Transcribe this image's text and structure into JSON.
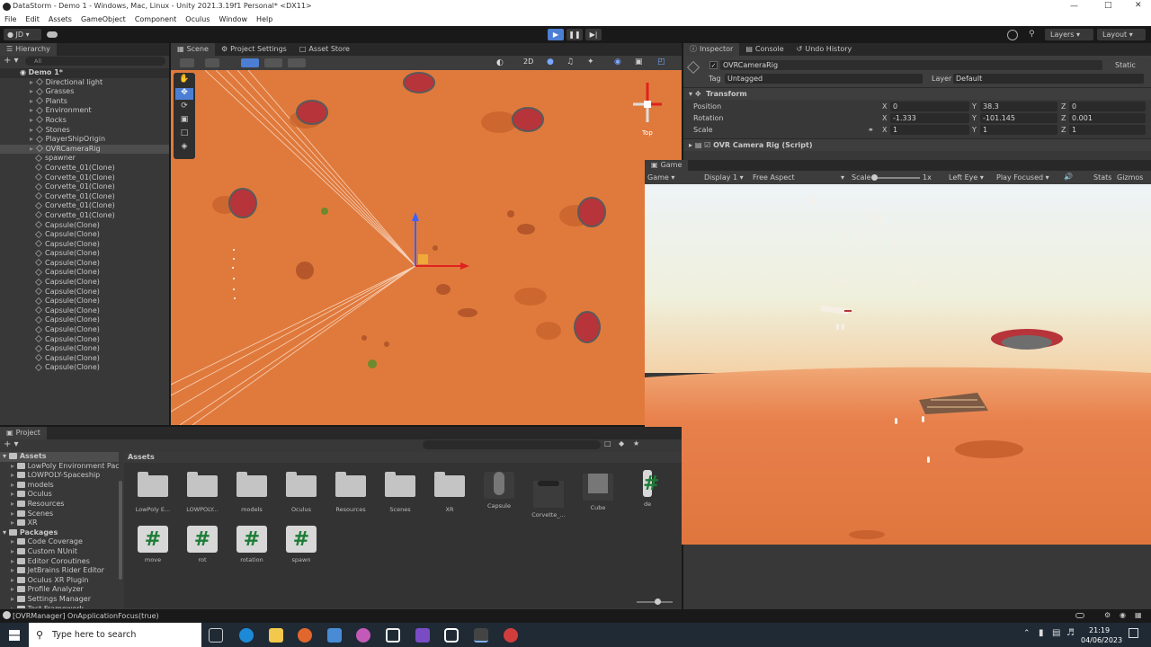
{
  "window": {
    "title": "DataStorm - Demo 1 - Windows, Mac, Linux - Unity 2021.3.19f1 Personal* <DX11>"
  },
  "menu": [
    "File",
    "Edit",
    "Assets",
    "GameObject",
    "Component",
    "Oculus",
    "Window",
    "Help"
  ],
  "toolbar": {
    "account": "JD",
    "layers": "Layers",
    "layout": "Layout"
  },
  "hierarchy": {
    "tab": "Hierarchy",
    "search_placeholder": "All",
    "scene": "Demo 1*",
    "items": [
      "Directional light",
      "Grasses",
      "Plants",
      "Environment",
      "Rocks",
      "Stones",
      "PlayerShipOrigin",
      "OVRCameraRig",
      "spawner",
      "Corvette_01(Clone)",
      "Corvette_01(Clone)",
      "Corvette_01(Clone)",
      "Corvette_01(Clone)",
      "Corvette_01(Clone)",
      "Corvette_01(Clone)",
      "Capsule(Clone)",
      "Capsule(Clone)",
      "Capsule(Clone)",
      "Capsule(Clone)",
      "Capsule(Clone)",
      "Capsule(Clone)",
      "Capsule(Clone)",
      "Capsule(Clone)",
      "Capsule(Clone)",
      "Capsule(Clone)",
      "Capsule(Clone)",
      "Capsule(Clone)",
      "Capsule(Clone)",
      "Capsule(Clone)",
      "Capsule(Clone)",
      "Capsule(Clone)"
    ]
  },
  "scene_tabs": [
    "Scene",
    "Project Settings",
    "Asset Store"
  ],
  "scene": {
    "mode_2d": "2D",
    "gizmo_view": "Top"
  },
  "inspector": {
    "tabs": [
      "Inspector",
      "Console",
      "Undo History"
    ],
    "object_name": "OVRCameraRig",
    "static_label": "Static",
    "tag_label": "Tag",
    "tag_value": "Untagged",
    "layer_label": "Layer",
    "layer_value": "Default",
    "transform": "Transform",
    "position": {
      "label": "Position",
      "x": "0",
      "y": "38.3",
      "z": "0"
    },
    "rotation": {
      "label": "Rotation",
      "x": "-1.333",
      "y": "-101.145",
      "z": "0.001"
    },
    "scale": {
      "label": "Scale",
      "x": "1",
      "y": "1",
      "z": "1"
    },
    "component": "OVR Camera Rig (Script)"
  },
  "game": {
    "tab": "Game",
    "display_mode": "Game",
    "display": "Display 1",
    "aspect": "Free Aspect",
    "scale_label": "Scale",
    "scale_value": "1x",
    "eye": "Left Eye",
    "play_focus": "Play Focused",
    "stats": "Stats",
    "gizmos": "Gizmos"
  },
  "project": {
    "tab": "Project",
    "breadcrumb": "Assets",
    "tree": {
      "assets_root": "Assets",
      "assets": [
        "LowPoly Environment Pac",
        "LOWPOLY-Spaceship",
        "models",
        "Oculus",
        "Resources",
        "Scenes",
        "XR"
      ],
      "packages_root": "Packages",
      "packages": [
        "Code Coverage",
        "Custom NUnit",
        "Editor Coroutines",
        "JetBrains Rider Editor",
        "Oculus XR Plugin",
        "Profile Analyzer",
        "Settings Manager",
        "Test Framework"
      ]
    },
    "grid_row1": [
      "LowPoly E...",
      "LOWPOLY...",
      "models",
      "Oculus",
      "Resources",
      "Scenes",
      "XR",
      "Capsule",
      "Corvette_...",
      "Cube",
      "de"
    ],
    "grid_row2": [
      "move",
      "rot",
      "rotation",
      "spawn"
    ]
  },
  "status": {
    "message": "[OVRManager] OnApplicationFocus(true)"
  },
  "taskbar": {
    "search_placeholder": "Type here to search",
    "time": "21:19",
    "date": "04/06/2023"
  },
  "colors": {
    "accent": "#4c7fd4",
    "desert": "#e07a3c",
    "sky": "#e8eef2"
  }
}
